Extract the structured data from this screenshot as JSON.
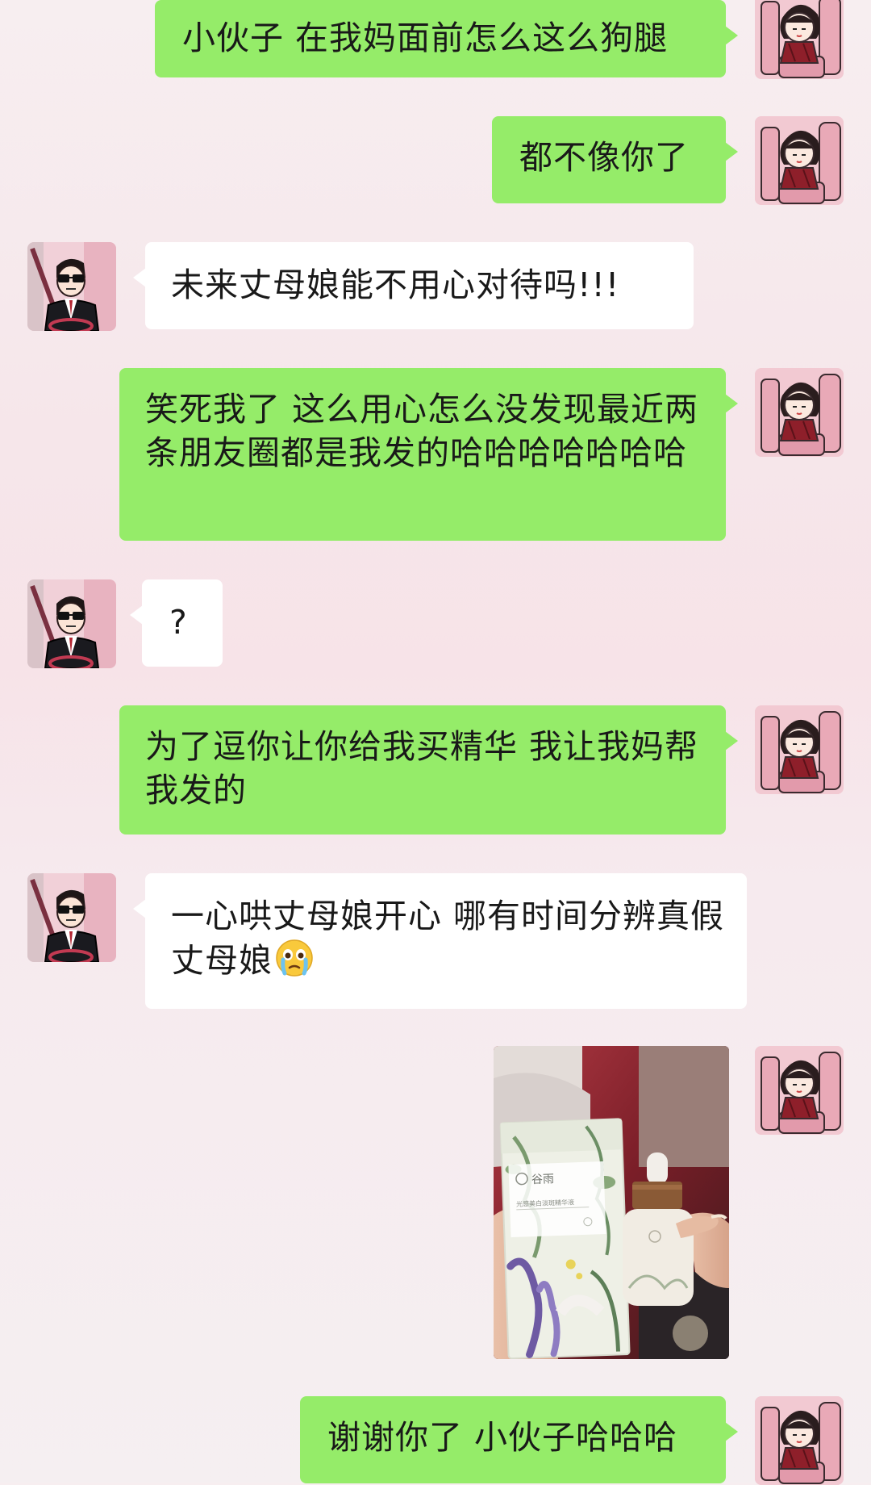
{
  "messages": [
    {
      "sender": "me",
      "text": "小伙子 在我妈面前怎么这么狗腿"
    },
    {
      "sender": "me",
      "text": "都不像你了"
    },
    {
      "sender": "them",
      "text": "未来丈母娘能不用心对待吗!!!"
    },
    {
      "sender": "me",
      "text": "笑死我了 这么用心怎么没发现最近两条朋友圈都是我发的哈哈哈哈哈哈哈"
    },
    {
      "sender": "them",
      "text": "?"
    },
    {
      "sender": "me",
      "text": "为了逗你让你给我买精华 我让我妈帮我发的"
    },
    {
      "sender": "them",
      "text": "一心哄丈母娘开心 哪有时间分辨真假丈母娘",
      "emoji": "crying-face-emoji"
    },
    {
      "sender": "me",
      "type": "photo",
      "photo": {
        "brand": "谷雨",
        "product_line": "光感美白淡斑精华液"
      }
    },
    {
      "sender": "me",
      "text": "谢谢你了 小伙子哈哈哈"
    }
  ],
  "avatars": {
    "me": "girl-cartoon-avatar",
    "them": "sunglasses-driver-cartoon-avatar"
  },
  "colors": {
    "me_bubble": "#95ec69",
    "them_bubble": "#ffffff",
    "text": "#191919"
  }
}
